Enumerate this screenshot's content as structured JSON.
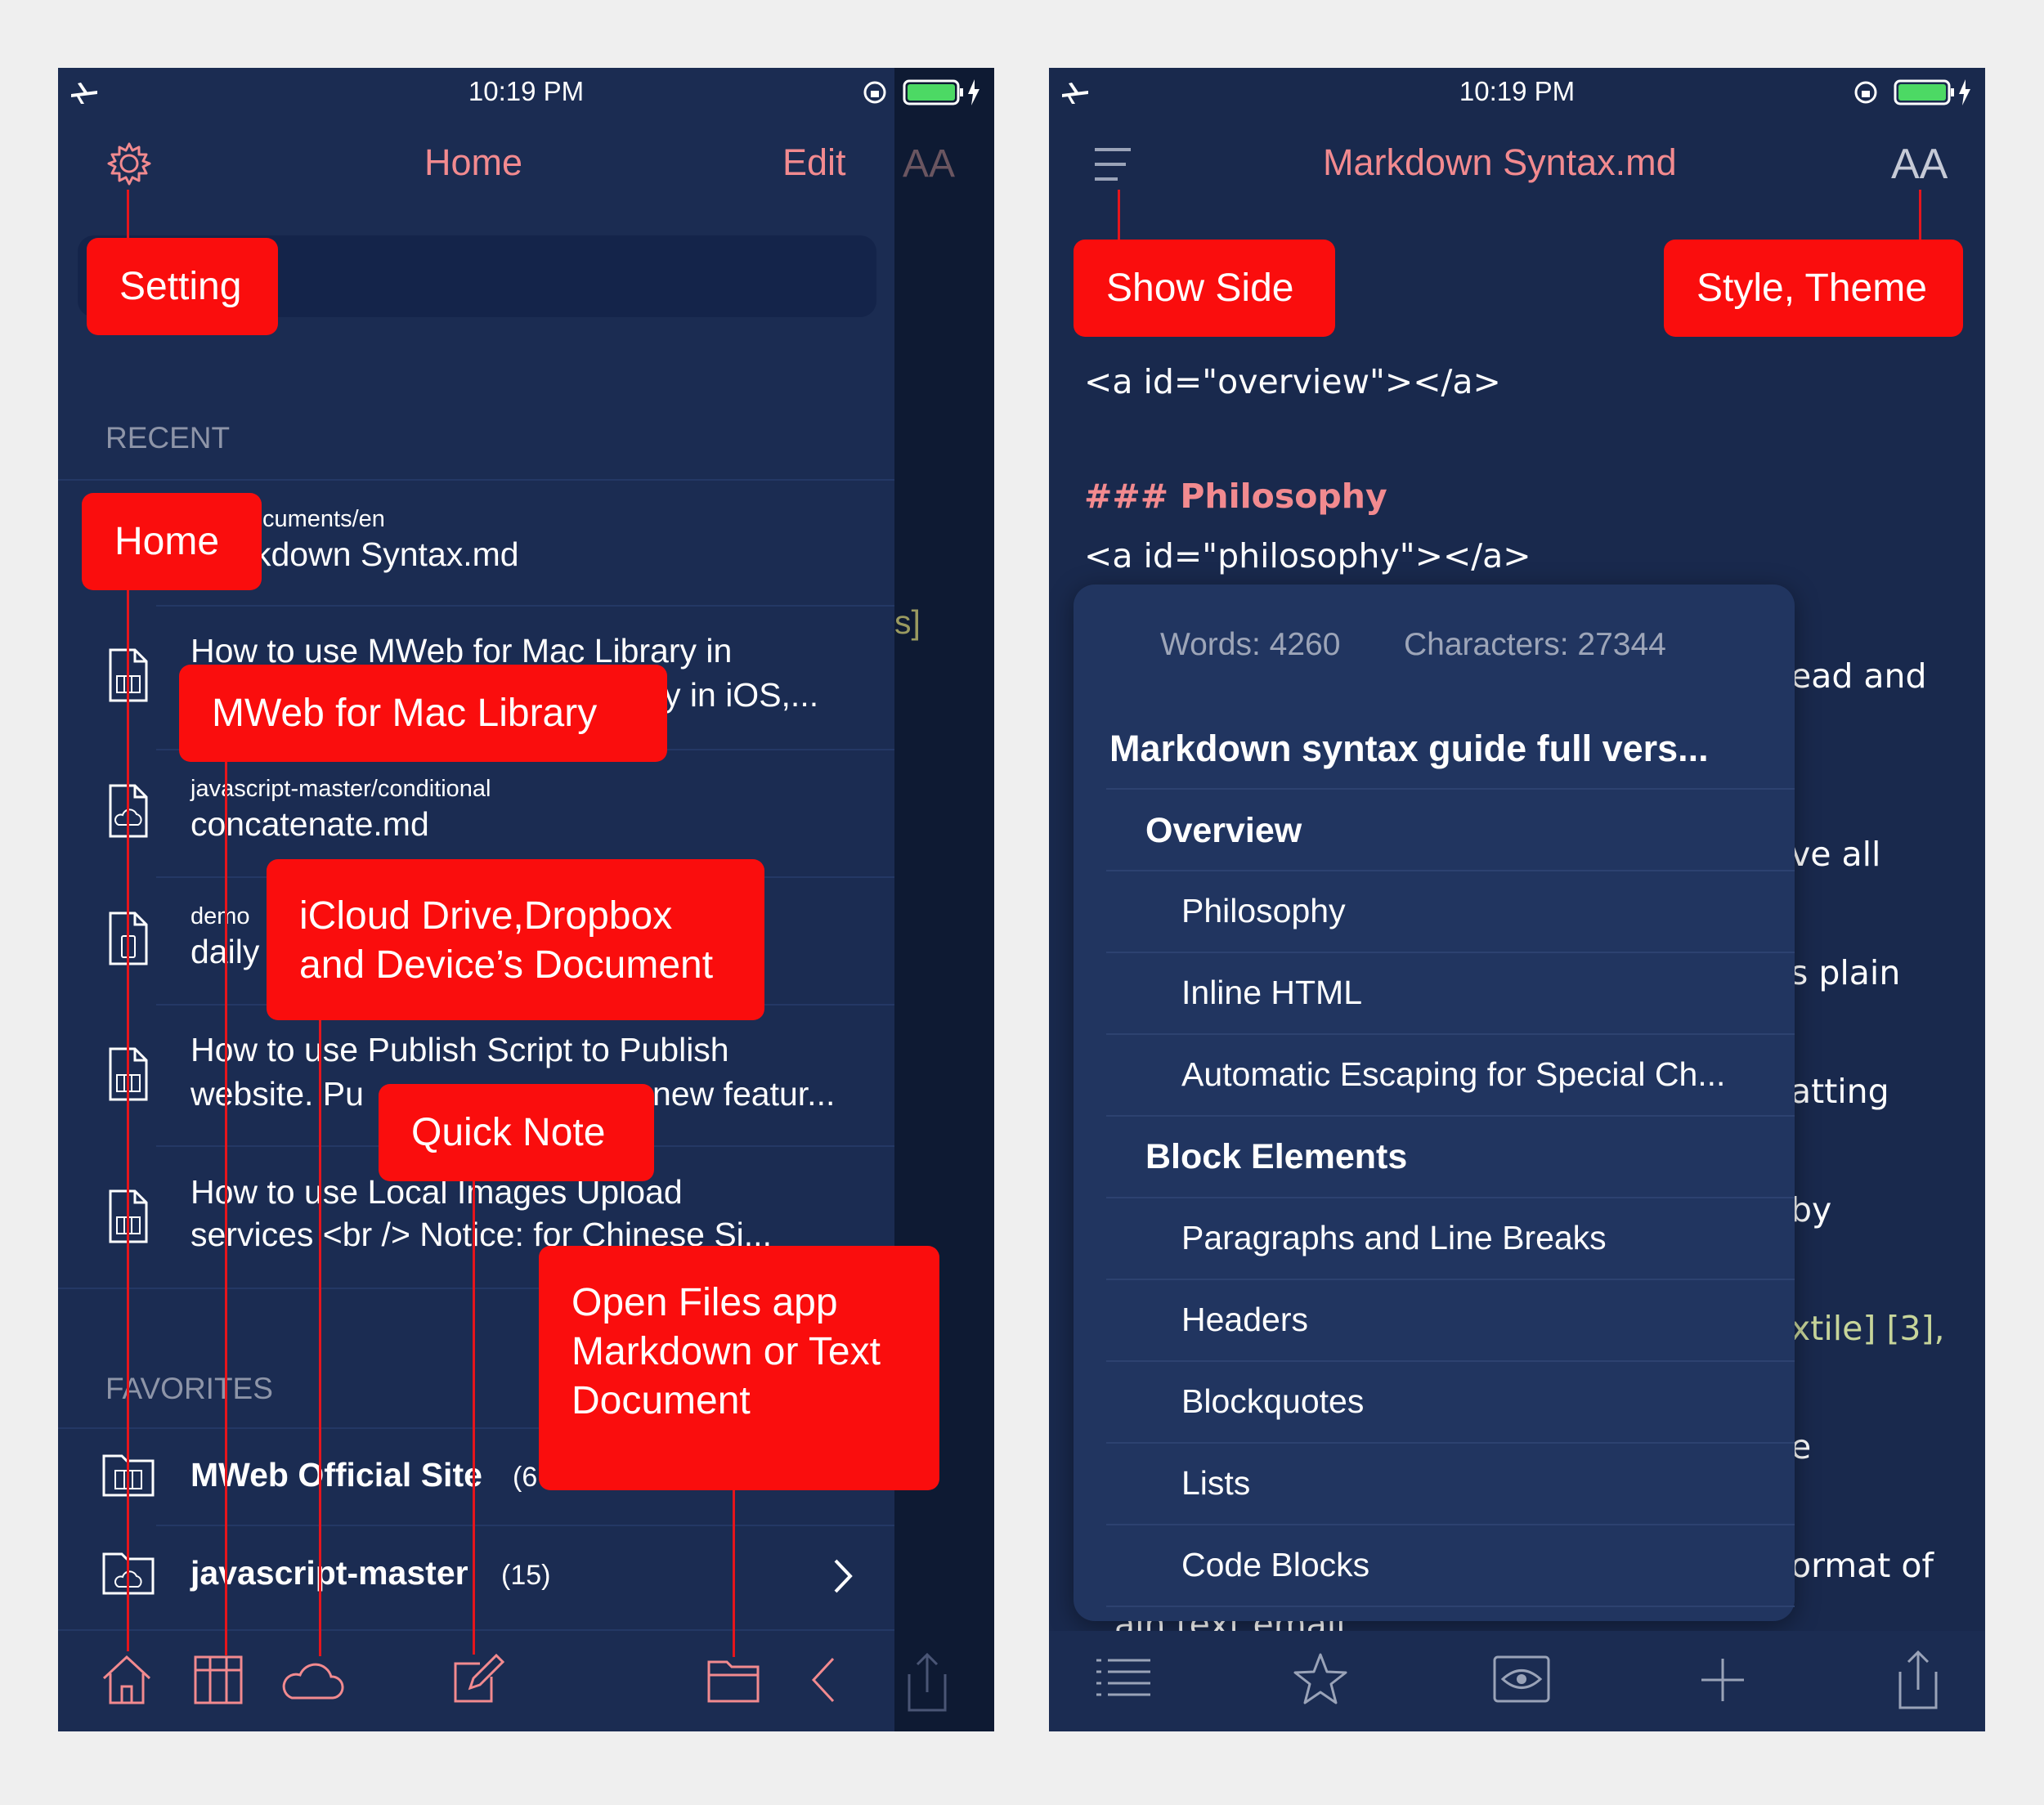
{
  "left": {
    "status": {
      "time": "10:19 PM"
    },
    "nav": {
      "title": "Home",
      "edit": "Edit",
      "aa": "AA"
    },
    "sections": {
      "recent": "RECENT",
      "favorites": "FAVORITES"
    },
    "recent": [
      {
        "path": "cuments/en",
        "title": "kdown Syntax.md"
      },
      {
        "path": "",
        "title": "How to use MWeb for Mac Library in",
        "title2": "y in iOS,..."
      },
      {
        "path": "javascript-master/conditional",
        "title": "concatenate.md"
      },
      {
        "path": "demo",
        "title": "daily"
      },
      {
        "path": "",
        "title": "How to use Publish Script to Publish",
        "title2": "website.  Pu",
        "title3": "new featur..."
      },
      {
        "path": "",
        "title": "How to use Local Images Upload",
        "title2": "services  <br />  Notice: for Chinese Si..."
      }
    ],
    "favorites": [
      {
        "name": "MWeb Official Site",
        "count": "(6"
      },
      {
        "name": "javascript-master",
        "count": "(15)"
      }
    ],
    "backdrop_text": "s]"
  },
  "right": {
    "status": {
      "time": "10:19 PM"
    },
    "nav": {
      "title": "Markdown Syntax.md",
      "aa": "AA"
    },
    "editor": {
      "line1": "<a id=\"overview\"></a>",
      "heading": "### Philosophy",
      "line2": "<a id=\"philosophy\"></a>",
      "fragments": [
        "ead and",
        "ve all",
        "s plain",
        "atting",
        "by",
        "xtile] [3],",
        "e",
        "ormat of",
        "ain text email"
      ]
    },
    "toc": {
      "words": "Words: 4260",
      "characters": "Characters: 27344",
      "title": "Markdown syntax guide full vers...",
      "items": [
        {
          "label": "Overview",
          "level": 1
        },
        {
          "label": "Philosophy",
          "level": 2
        },
        {
          "label": "Inline HTML",
          "level": 2
        },
        {
          "label": "Automatic Escaping for Special Ch...",
          "level": 2
        },
        {
          "label": "Block Elements",
          "level": 1
        },
        {
          "label": "Paragraphs and Line Breaks",
          "level": 2
        },
        {
          "label": "Headers",
          "level": 2
        },
        {
          "label": "Blockquotes",
          "level": 2
        },
        {
          "label": "Lists",
          "level": 2
        },
        {
          "label": "Code Blocks",
          "level": 2
        }
      ]
    }
  },
  "callouts": {
    "setting": "Setting",
    "home": "Home",
    "library": "MWeb for Mac Library",
    "icloud_line1": "iCloud Drive,Dropbox",
    "icloud_line2": "and Device’s Document",
    "quick_note": "Quick Note",
    "open_files_line1": "Open Files app",
    "open_files_line2": "Markdown or Text",
    "open_files_line3": "Document",
    "show_side": "Show Side",
    "style_theme": "Style, Theme"
  },
  "colors": {
    "background": "#1b2c52",
    "accent": "#f28a8f",
    "callout": "#fa0d0d",
    "heading": "#f28a8f"
  }
}
